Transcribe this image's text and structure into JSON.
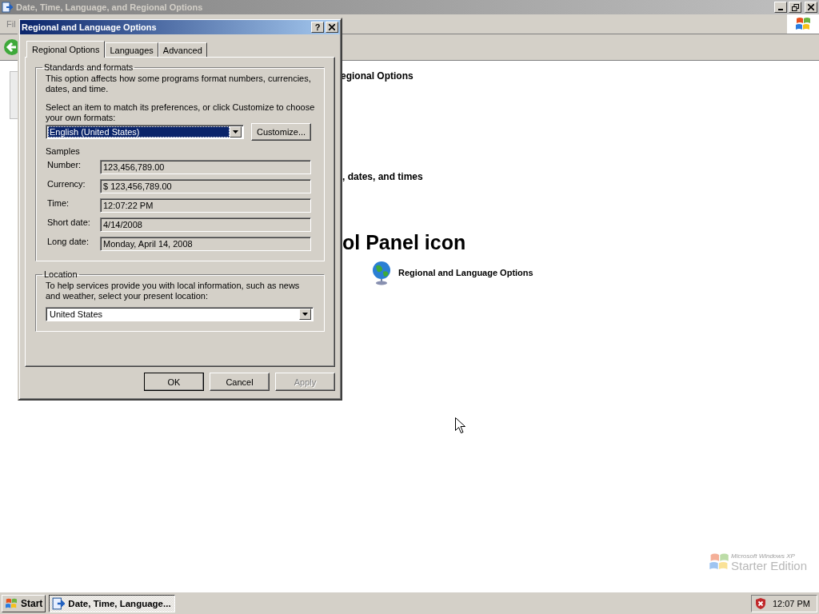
{
  "main_window": {
    "title": "Date, Time, Language, and Regional Options",
    "active": false,
    "menu": [
      "Fil"
    ],
    "content": {
      "heading_1": "egional Options",
      "heading_2": ", dates, and times",
      "section_title": "ol Panel icon",
      "link": "Regional and Language Options"
    }
  },
  "dialog": {
    "title": "Regional and Language Options",
    "help": "?",
    "tabs": [
      {
        "label": "Regional Options",
        "selected": true
      },
      {
        "label": "Languages",
        "selected": false
      },
      {
        "label": "Advanced",
        "selected": false
      }
    ],
    "standards": {
      "legend": "Standards and formats",
      "description": "This option affects how some programs format numbers, currencies, dates, and time.",
      "instruction": "Select an item to match its preferences, or click Customize to choose your own formats:",
      "format": {
        "value": "English (United States)",
        "focused": true
      },
      "customize": "Customize...",
      "samples_title": "Samples",
      "samples": [
        {
          "label": "Number:",
          "value": "123,456,789.00"
        },
        {
          "label": "Currency:",
          "value": "$ 123,456,789.00"
        },
        {
          "label": "Time:",
          "value": "12:07:22 PM"
        },
        {
          "label": "Short date:",
          "value": "4/14/2008"
        },
        {
          "label": "Long date:",
          "value": "Monday, April 14, 2008"
        }
      ]
    },
    "location": {
      "legend": "Location",
      "description": "To help services provide you with local information, such as news and weather, select your present location:",
      "value": "United States"
    },
    "buttons": [
      {
        "label": "OK",
        "disabled": false,
        "default": true
      },
      {
        "label": "Cancel",
        "disabled": false,
        "default": false
      },
      {
        "label": "Apply",
        "disabled": true,
        "default": false
      }
    ]
  },
  "desktop_logo": {
    "line_1": "Microsoft Windows XP",
    "line_2": "Starter Edition"
  },
  "taskbar": {
    "start": "Start",
    "tasks": [
      {
        "label": "Date, Time, Language...",
        "selected": true
      }
    ],
    "clock": "12:07 PM"
  }
}
